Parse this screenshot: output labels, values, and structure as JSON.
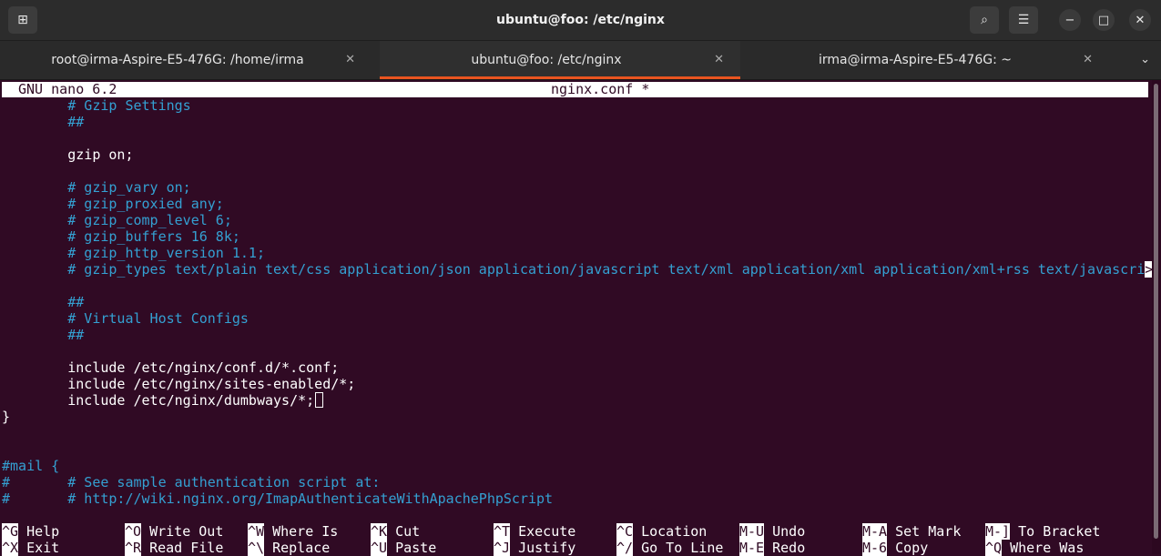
{
  "window": {
    "title": "ubuntu@foo: /etc/nginx",
    "new_tab_glyph": "⊞",
    "search_glyph": "⌕",
    "menu_glyph": "☰",
    "minimize_glyph": "−",
    "maximize_glyph": "□",
    "close_glyph": "✕"
  },
  "tabs": [
    {
      "label": "root@irma-Aspire-E5-476G: /home/irma",
      "close": "✕"
    },
    {
      "label": "ubuntu@foo: /etc/nginx",
      "close": "✕"
    },
    {
      "label": "irma@irma-Aspire-E5-476G: ~",
      "close": "✕"
    }
  ],
  "tab_menu_glyph": "⌄",
  "nano": {
    "version": "GNU nano 6.2",
    "filename": "nginx.conf *"
  },
  "lines": [
    "        # Gzip Settings",
    "        ##",
    "",
    "        gzip on;",
    "",
    "        # gzip_vary on;",
    "        # gzip_proxied any;",
    "        # gzip_comp_level 6;",
    "        # gzip_buffers 16 8k;",
    "        # gzip_http_version 1.1;",
    "        # gzip_types text/plain text/css application/json application/javascript text/xml application/xml application/xml+rss text/javascri",
    "",
    "        ##",
    "        # Virtual Host Configs",
    "        ##",
    "",
    "        include /etc/nginx/conf.d/*.conf;",
    "        include /etc/nginx/sites-enabled/*;",
    "        include /etc/nginx/dumbways/*;",
    "}",
    "",
    "",
    "#mail {",
    "#       # See sample authentication script at:",
    "#       # http://wiki.nginx.org/ImapAuthenticateWithApachePhpScript"
  ],
  "truncation_marker": ">",
  "shortcuts_row1": [
    {
      "key": "^G",
      "label": "Help"
    },
    {
      "key": "^O",
      "label": "Write Out"
    },
    {
      "key": "^W",
      "label": "Where Is"
    },
    {
      "key": "^K",
      "label": "Cut"
    },
    {
      "key": "^T",
      "label": "Execute"
    },
    {
      "key": "^C",
      "label": "Location"
    },
    {
      "key": "M-U",
      "label": "Undo"
    },
    {
      "key": "M-A",
      "label": "Set Mark"
    },
    {
      "key": "M-]",
      "label": "To Bracket"
    }
  ],
  "shortcuts_row2": [
    {
      "key": "^X",
      "label": "Exit"
    },
    {
      "key": "^R",
      "label": "Read File"
    },
    {
      "key": "^\\",
      "label": "Replace"
    },
    {
      "key": "^U",
      "label": "Paste"
    },
    {
      "key": "^J",
      "label": "Justify"
    },
    {
      "key": "^/",
      "label": "Go To Line"
    },
    {
      "key": "M-E",
      "label": "Redo"
    },
    {
      "key": "M-6",
      "label": "Copy"
    },
    {
      "key": "^Q",
      "label": "Where Was"
    }
  ],
  "colors": {
    "terminal_bg": "#300a24",
    "comment": "#34a0d2",
    "tab_accent": "#e95420"
  }
}
